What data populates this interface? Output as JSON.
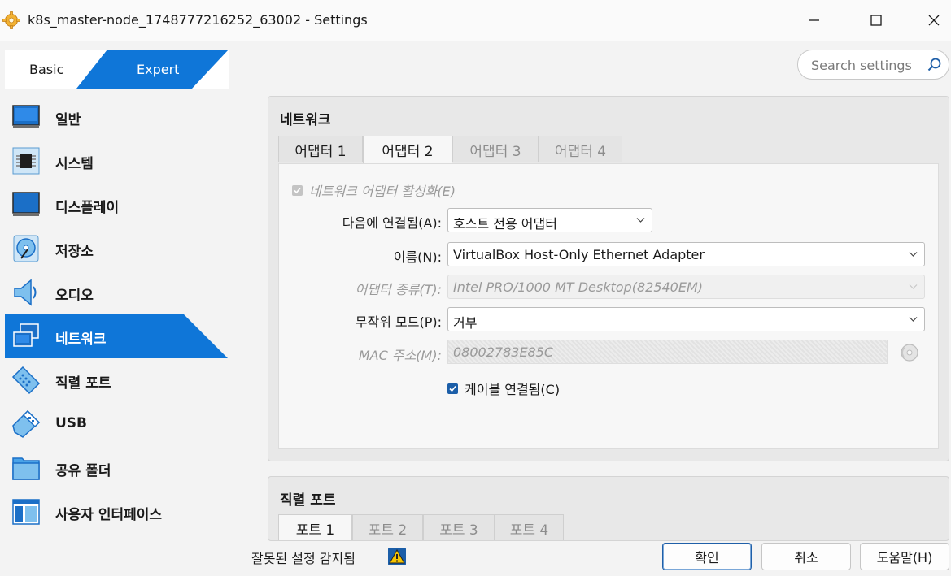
{
  "window": {
    "title": "k8s_master-node_1748777216252_63002 - Settings"
  },
  "mode": {
    "basic_label": "Basic",
    "expert_label": "Expert",
    "selected": "Expert"
  },
  "search": {
    "placeholder": "Search settings"
  },
  "sidebar": {
    "items": [
      {
        "label": "일반",
        "icon": "general-icon"
      },
      {
        "label": "시스템",
        "icon": "system-chip-icon"
      },
      {
        "label": "디스플레이",
        "icon": "display-monitor-icon"
      },
      {
        "label": "저장소",
        "icon": "storage-disk-icon"
      },
      {
        "label": "오디오",
        "icon": "audio-speaker-icon"
      },
      {
        "label": "네트워크",
        "icon": "network-icon",
        "selected": true
      },
      {
        "label": "직렬 포트",
        "icon": "serial-port-icon"
      },
      {
        "label": "USB",
        "icon": "usb-icon"
      },
      {
        "label": "공유 폴더",
        "icon": "shared-folder-icon"
      },
      {
        "label": "사용자 인터페이스",
        "icon": "user-interface-icon"
      }
    ]
  },
  "network": {
    "title": "네트워크",
    "tabs": [
      {
        "label": "어댑터 1"
      },
      {
        "label": "어댑터 2",
        "active": true
      },
      {
        "label": "어댑터 3",
        "disabled": true
      },
      {
        "label": "어댑터 4",
        "disabled": true
      }
    ],
    "enable_label": "네트워크 어댑터 활성화(E)",
    "attached_label": "다음에 연결됨(A):",
    "attached_value": "호스트 전용 어댑터",
    "name_label": "이름(N):",
    "name_value": "VirtualBox Host-Only Ethernet Adapter",
    "adapter_type_label": "어댑터 종류(T):",
    "adapter_type_value": "Intel PRO/1000 MT Desktop(82540EM)",
    "promisc_label": "무작위 모드(P):",
    "promisc_value": "거부",
    "mac_label": "MAC 주소(M):",
    "mac_value": "08002783E85C",
    "cable_label": "케이블 연결됨(C)"
  },
  "serial": {
    "title": "직렬 포트",
    "tabs": [
      {
        "label": "포트 1"
      },
      {
        "label": "포트 2"
      },
      {
        "label": "포트 3"
      },
      {
        "label": "포트 4"
      }
    ]
  },
  "footer": {
    "warning_text": "잘못된 설정 감지됨",
    "ok_label": "확인",
    "cancel_label": "취소",
    "help_label": "도움말(H)"
  },
  "colors": {
    "accent": "#0f76d8",
    "selected_text": "#ffffff"
  }
}
